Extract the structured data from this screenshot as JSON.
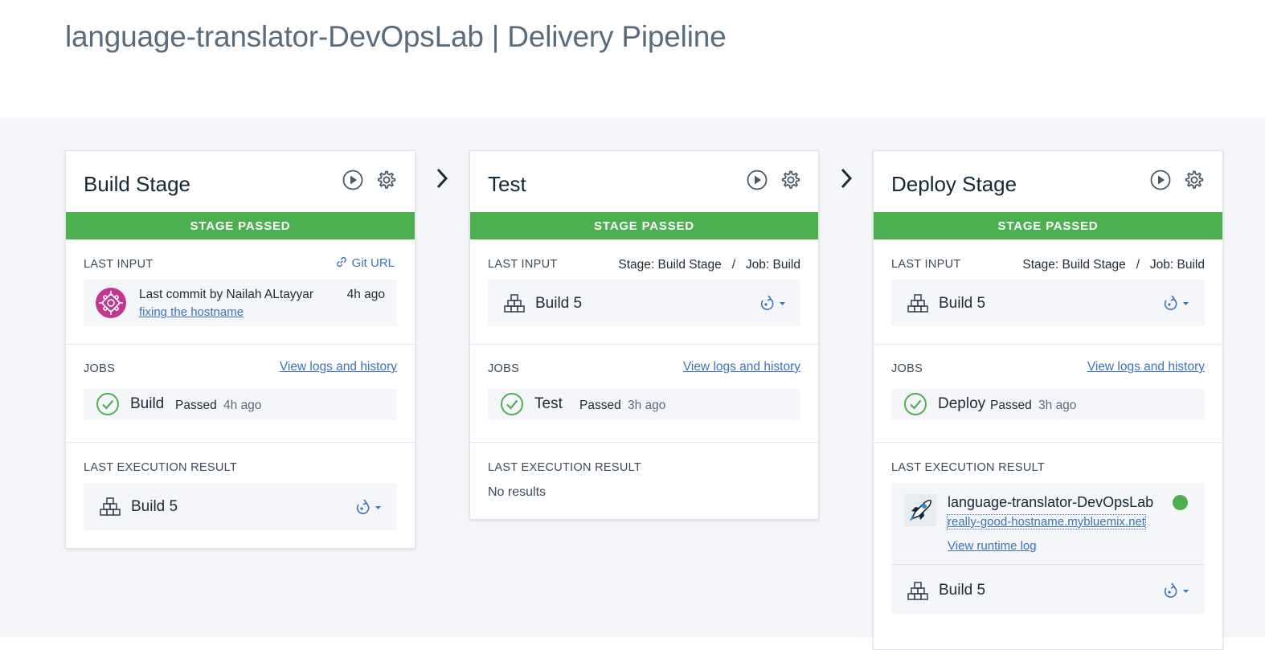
{
  "header": {
    "title": "language-translator-DevOpsLab | Delivery Pipeline"
  },
  "colors": {
    "passed": "#4caf50",
    "link": "#3b73b9",
    "status_dot": "#4caf50"
  },
  "labels": {
    "last_input": "LAST INPUT",
    "jobs": "JOBS",
    "last_execution": "LAST EXECUTION RESULT",
    "view_logs": "View logs and history",
    "passed": "Passed"
  },
  "stages": [
    {
      "name": "Build Stage",
      "status": "STAGE PASSED",
      "input": {
        "git_url_label": "Git URL",
        "commit_text": "Last commit by Nailah ALtayyar",
        "commit_time": "4h ago",
        "commit_message": "fixing the hostname"
      },
      "job": {
        "name": "Build",
        "status": "Passed",
        "time": "4h ago"
      },
      "result": {
        "build": "Build 5"
      }
    },
    {
      "name": "Test",
      "status": "STAGE PASSED",
      "input": {
        "source": "Stage: Build Stage   /   Job: Build",
        "build": "Build 5"
      },
      "job": {
        "name": "Test",
        "status": "Passed",
        "time": "3h ago"
      },
      "result": {
        "text": "No results"
      }
    },
    {
      "name": "Deploy Stage",
      "status": "STAGE PASSED",
      "input": {
        "source": "Stage: Build Stage   /   Job: Build",
        "build": "Build 5"
      },
      "job": {
        "name": "Deploy",
        "status": "Passed",
        "time": "3h ago"
      },
      "result": {
        "app_name": "language-translator-DevOpsLab",
        "app_url": "really-good-hostname.mybluemix.net",
        "runtime_log": "View runtime log",
        "build": "Build 5"
      }
    }
  ]
}
